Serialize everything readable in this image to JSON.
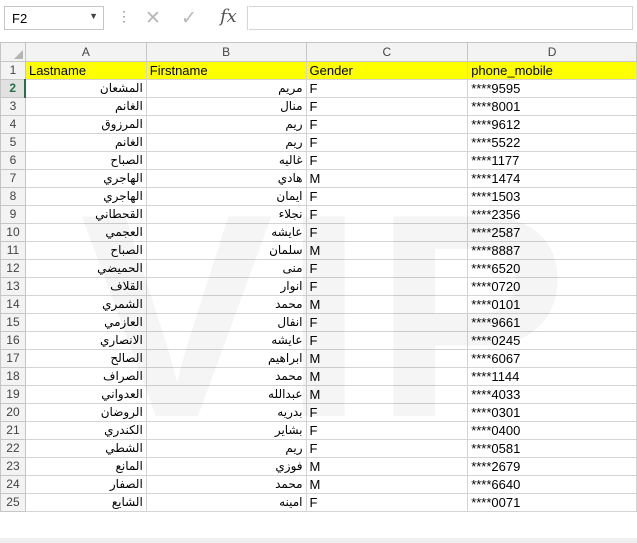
{
  "namebox": "F2",
  "formula": "",
  "columns": [
    "A",
    "B",
    "C",
    "D"
  ],
  "headers": [
    "Lastname",
    "Firstname",
    "Gender",
    "phone_mobile"
  ],
  "watermark": "VIP",
  "rows": [
    {
      "n": "2",
      "last": "المشعان",
      "first": "مريم",
      "gender": "F",
      "phone": "****9595"
    },
    {
      "n": "3",
      "last": "الغانم",
      "first": "منال",
      "gender": "F",
      "phone": "****8001"
    },
    {
      "n": "4",
      "last": "المرزوق",
      "first": "ريم",
      "gender": "F",
      "phone": "****9612"
    },
    {
      "n": "5",
      "last": "الغانم",
      "first": "ريم",
      "gender": "F",
      "phone": "****5522"
    },
    {
      "n": "6",
      "last": "الصباح",
      "first": "غاليه",
      "gender": "F",
      "phone": "****1177"
    },
    {
      "n": "7",
      "last": "الهاجري",
      "first": "هادي",
      "gender": "M",
      "phone": "****1474"
    },
    {
      "n": "8",
      "last": "الهاجري",
      "first": "ايمان",
      "gender": "F",
      "phone": "****1503"
    },
    {
      "n": "9",
      "last": "القحطاني",
      "first": "نجلاء",
      "gender": "F",
      "phone": "****2356"
    },
    {
      "n": "10",
      "last": "العجمي",
      "first": "عايشه",
      "gender": "F",
      "phone": "****2587"
    },
    {
      "n": "11",
      "last": "الصباح",
      "first": "سلمان",
      "gender": "M",
      "phone": "****8887"
    },
    {
      "n": "12",
      "last": "الحميضي",
      "first": "منى",
      "gender": "F",
      "phone": "****6520"
    },
    {
      "n": "13",
      "last": "القلاف",
      "first": "انوار",
      "gender": "F",
      "phone": "****0720"
    },
    {
      "n": "14",
      "last": "الشمري",
      "first": "محمد",
      "gender": "M",
      "phone": "****0101"
    },
    {
      "n": "15",
      "last": "العازمي",
      "first": "انفال",
      "gender": "F",
      "phone": "****9661"
    },
    {
      "n": "16",
      "last": "الانصاري",
      "first": "عايشه",
      "gender": "F",
      "phone": "****0245"
    },
    {
      "n": "17",
      "last": "الصالح",
      "first": "ابراهيم",
      "gender": "M",
      "phone": "****6067"
    },
    {
      "n": "18",
      "last": "الصراف",
      "first": "محمد",
      "gender": "M",
      "phone": "****1144"
    },
    {
      "n": "19",
      "last": "العدواني",
      "first": "عبدالله",
      "gender": "M",
      "phone": "****4033"
    },
    {
      "n": "20",
      "last": "الروضان",
      "first": "بدريه",
      "gender": "F",
      "phone": "****0301"
    },
    {
      "n": "21",
      "last": "الكندري",
      "first": "بشاير",
      "gender": "F",
      "phone": "****0400"
    },
    {
      "n": "22",
      "last": "الشطي",
      "first": "ريم",
      "gender": "F",
      "phone": "****0581"
    },
    {
      "n": "23",
      "last": "المانع",
      "first": "فوزي",
      "gender": "M",
      "phone": "****2679"
    },
    {
      "n": "24",
      "last": "الصفار",
      "first": "محمد",
      "gender": "M",
      "phone": "****6640"
    },
    {
      "n": "25",
      "last": "الشايع",
      "first": "امينه",
      "gender": "F",
      "phone": "****0071"
    }
  ]
}
